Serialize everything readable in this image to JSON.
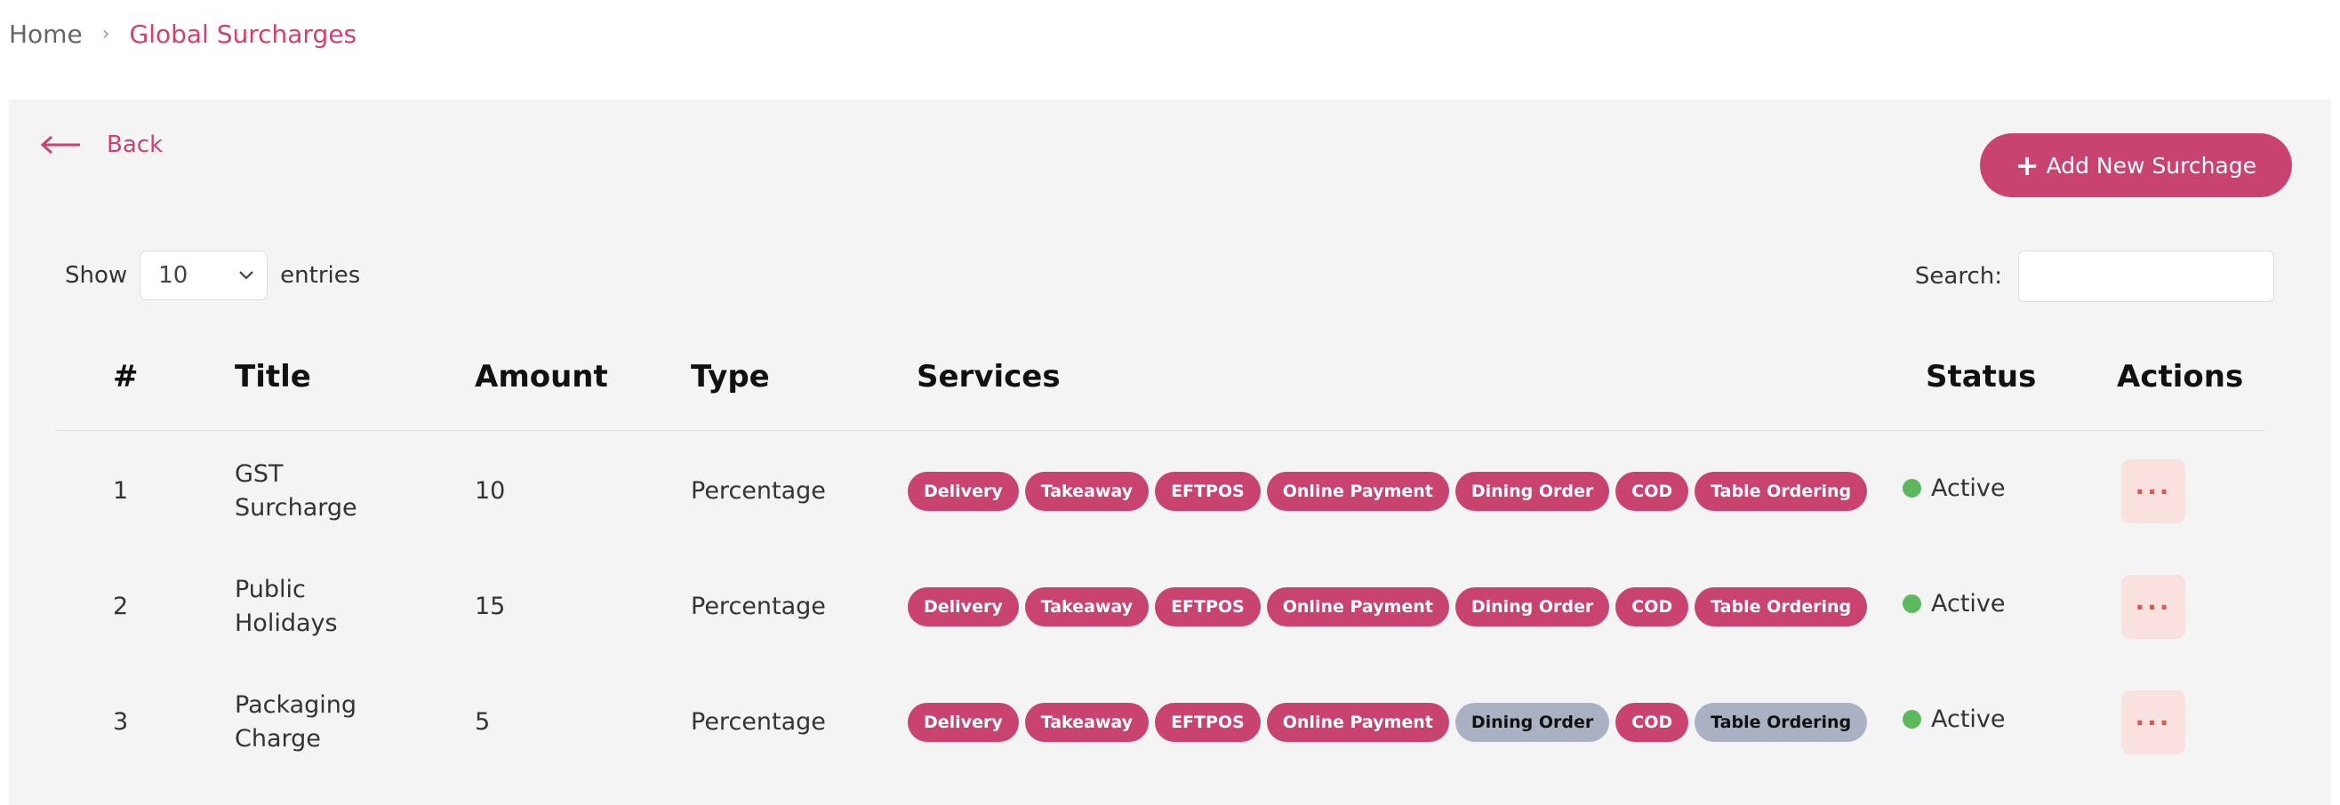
{
  "breadcrumb": {
    "home": "Home",
    "separator": "›",
    "current": "Global Surcharges"
  },
  "back_label": "Back",
  "add_button": {
    "icon": "+",
    "label": "Add New Surchage"
  },
  "table_controls": {
    "show_label": "Show",
    "entries_value": "10",
    "entries_label": "entries",
    "search_label": "Search:",
    "search_value": ""
  },
  "table": {
    "headers": [
      "#",
      "Title",
      "Amount",
      "Type",
      "Services",
      "Status",
      "Actions"
    ],
    "rows": [
      {
        "num": "1",
        "title_line1": "GST",
        "title_line2": "Surcharge",
        "amount": "10",
        "type": "Percentage",
        "services": [
          {
            "label": "Delivery",
            "active": true
          },
          {
            "label": "Takeaway",
            "active": true
          },
          {
            "label": "EFTPOS",
            "active": true
          },
          {
            "label": "Online Payment",
            "active": true
          },
          {
            "label": "Dining Order",
            "active": true
          },
          {
            "label": "COD",
            "active": true
          },
          {
            "label": "Table Ordering",
            "active": true
          }
        ],
        "status": "Active",
        "action": "···"
      },
      {
        "num": "2",
        "title_line1": "Public",
        "title_line2": "Holidays",
        "amount": "15",
        "type": "Percentage",
        "services": [
          {
            "label": "Delivery",
            "active": true
          },
          {
            "label": "Takeaway",
            "active": true
          },
          {
            "label": "EFTPOS",
            "active": true
          },
          {
            "label": "Online Payment",
            "active": true
          },
          {
            "label": "Dining Order",
            "active": true
          },
          {
            "label": "COD",
            "active": true
          },
          {
            "label": "Table Ordering",
            "active": true
          }
        ],
        "status": "Active",
        "action": "···"
      },
      {
        "num": "3",
        "title_line1": "Packaging",
        "title_line2": "Charge",
        "amount": "5",
        "type": "Percentage",
        "services": [
          {
            "label": "Delivery",
            "active": true
          },
          {
            "label": "Takeaway",
            "active": true
          },
          {
            "label": "EFTPOS",
            "active": true
          },
          {
            "label": "Online Payment",
            "active": true
          },
          {
            "label": "Dining Order",
            "active": false
          },
          {
            "label": "COD",
            "active": true
          },
          {
            "label": "Table Ordering",
            "active": false
          }
        ],
        "status": "Active",
        "action": "···"
      }
    ]
  },
  "colors": {
    "accent": "#c94371",
    "inactive_tag": "#aab1c3",
    "status_active": "#5cb85c",
    "action_bg": "#f9e1e0"
  }
}
